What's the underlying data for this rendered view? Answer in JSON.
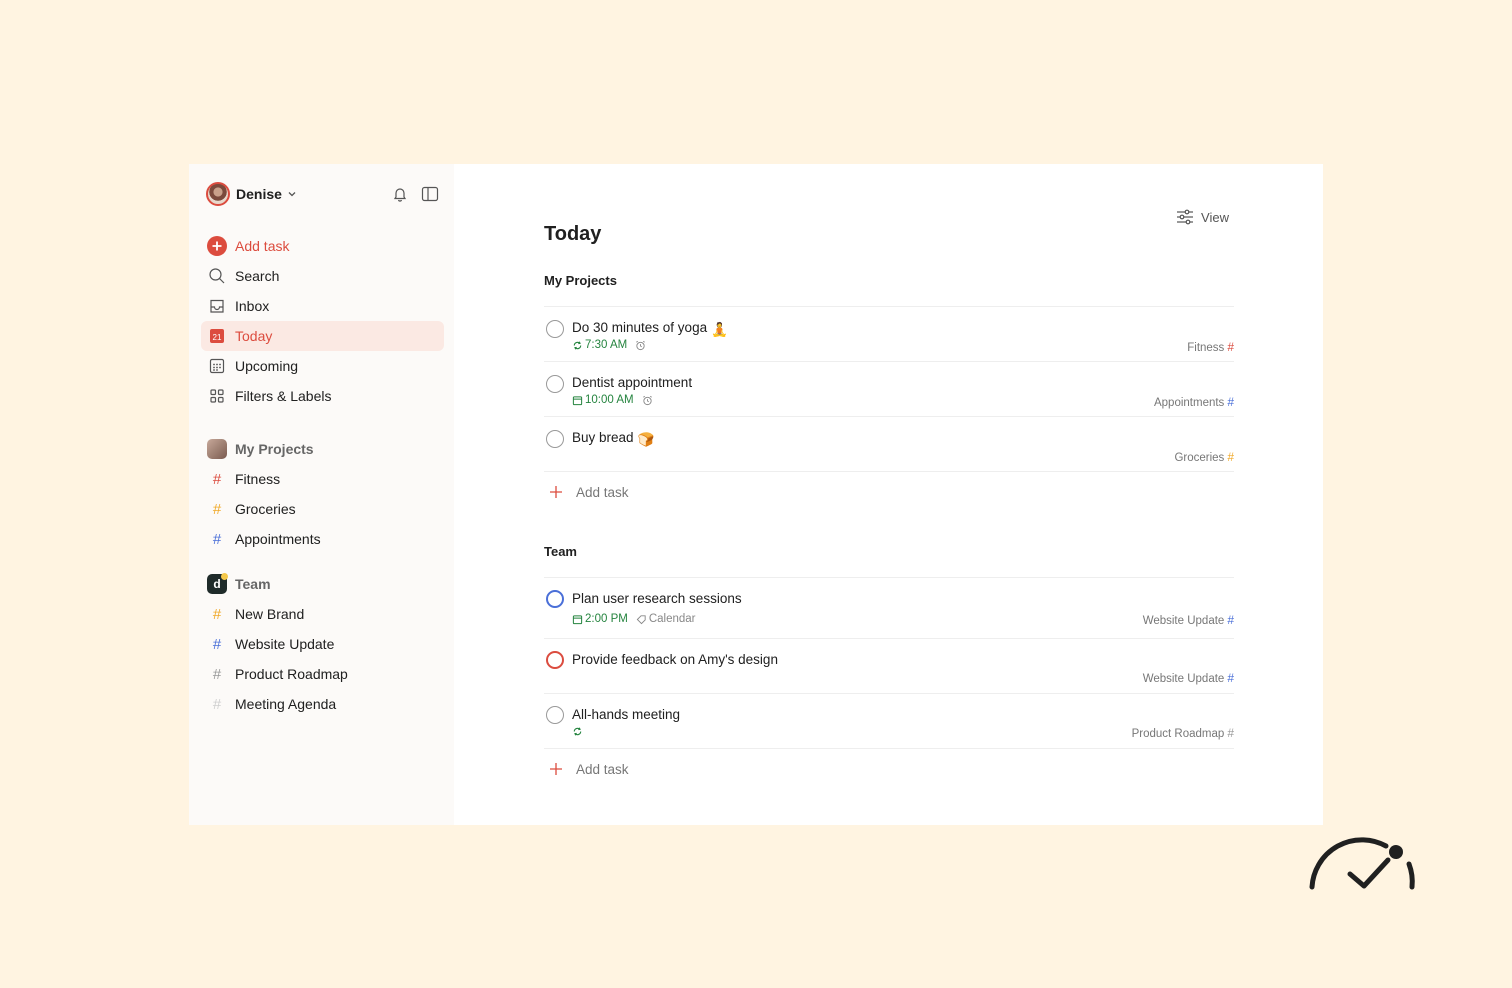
{
  "user": {
    "name": "Denise"
  },
  "sidebar": {
    "nav": [
      {
        "label": "Add task",
        "icon": "add-circle-icon",
        "kind": "add"
      },
      {
        "label": "Search",
        "icon": "search-icon"
      },
      {
        "label": "Inbox",
        "icon": "inbox-icon"
      },
      {
        "label": "Today",
        "icon": "calendar-today-icon",
        "active": true,
        "day": "21"
      },
      {
        "label": "Upcoming",
        "icon": "calendar-grid-icon"
      },
      {
        "label": "Filters & Labels",
        "icon": "filters-grid-icon"
      }
    ],
    "my_projects": {
      "title": "My Projects",
      "items": [
        {
          "label": "Fitness",
          "color": "#db4c3f"
        },
        {
          "label": "Groceries",
          "color": "#f0a929"
        },
        {
          "label": "Appointments",
          "color": "#4a6fd8"
        }
      ]
    },
    "team": {
      "title": "Team",
      "badge": "d",
      "items": [
        {
          "label": "New Brand",
          "color": "#f0a929"
        },
        {
          "label": "Website Update",
          "color": "#4a6fd8"
        },
        {
          "label": "Product Roadmap",
          "color": "#999999"
        },
        {
          "label": "Meeting Agenda",
          "color": "#cfcfcf"
        }
      ]
    }
  },
  "main": {
    "view_label": "View",
    "title": "Today",
    "add_task_label": "Add task",
    "sections": [
      {
        "title": "My Projects",
        "tasks": [
          {
            "title": "Do 30 minutes of yoga",
            "emoji": "🧘",
            "meta_time": "7:30 AM",
            "meta_icon": "recurring-icon",
            "alarm": true,
            "project": "Fitness",
            "project_color": "#db4c3f",
            "priority": "none"
          },
          {
            "title": "Dentist appointment",
            "meta_time": "10:00 AM",
            "meta_icon": "calendar-small-icon",
            "alarm": true,
            "project": "Appointments",
            "project_color": "#4a6fd8",
            "priority": "none"
          },
          {
            "title": "Buy bread",
            "emoji": "🍞",
            "project": "Groceries",
            "project_color": "#f0a929",
            "priority": "none"
          }
        ]
      },
      {
        "title": "Team",
        "tasks": [
          {
            "title": "Plan user research sessions",
            "meta_time": "2:00 PM",
            "meta_icon": "calendar-small-icon",
            "label": "Calendar",
            "project": "Website Update",
            "project_color": "#4a6fd8",
            "priority": "blue"
          },
          {
            "title": "Provide feedback on Amy's design",
            "project": "Website Update",
            "project_color": "#4a6fd8",
            "priority": "red"
          },
          {
            "title": "All-hands meeting",
            "meta_icon": "recurring-icon",
            "project": "Product Roadmap",
            "project_color": "#999999",
            "priority": "none"
          }
        ]
      }
    ]
  },
  "colors": {
    "accent": "#dc4c3e",
    "background": "#fff4e1",
    "sidebar": "#fcfaf8",
    "active_bg": "#fbe9e3",
    "due": "#25843f"
  }
}
